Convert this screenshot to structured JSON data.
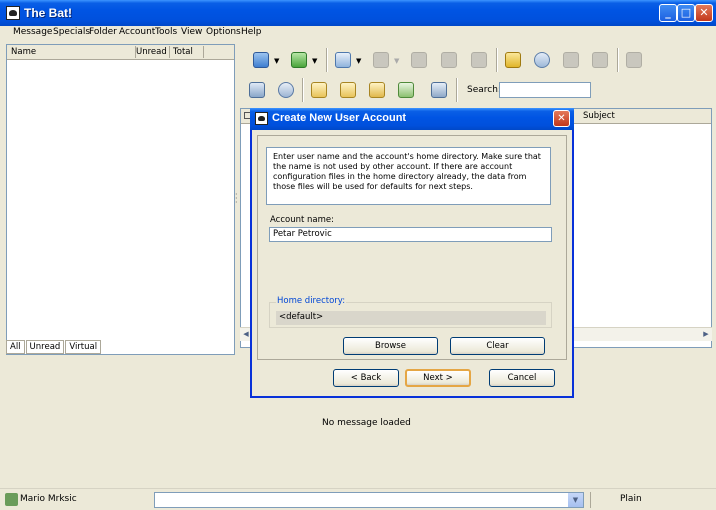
{
  "window": {
    "title": "The Bat!",
    "btn_min": "_",
    "btn_max": "□",
    "btn_close": "✕"
  },
  "menu": [
    "Message",
    "Specials",
    "Folder",
    "Account",
    "Tools",
    "View",
    "Options",
    "Help"
  ],
  "folder_pane": {
    "columns": [
      "Name",
      "Unread",
      "Total"
    ],
    "tabs": [
      "All",
      "Unread",
      "Virtual"
    ]
  },
  "search": {
    "label": "Search:",
    "value": ""
  },
  "message_list": {
    "subject_header": "Subject"
  },
  "preview": {
    "empty_text": "No message loaded"
  },
  "status": {
    "user": "Mario Mrksic",
    "mode": "Plain"
  },
  "dialog": {
    "title": "Create New User Account",
    "info": "Enter user name and the account's home directory. Make sure that the name is not used by other account. If there are account configuration files in the home directory already, the data from those files will be used for defaults for next steps.",
    "account_label": "Account name:",
    "account_value": "Petar Petrovic",
    "home_label": "Home directory:",
    "home_value": "<default>",
    "browse": "Browse",
    "clear": "Clear",
    "back": "< Back",
    "next": "Next >",
    "cancel": "Cancel"
  },
  "colors": {
    "title_blue": "#0054e3",
    "face": "#ece9d8",
    "border_blue": "#7f9db9",
    "link_blue": "#0046d5"
  },
  "toolbar_icons": [
    "get-mail-icon",
    "send-mail-icon",
    "new-message-icon",
    "reply-icon",
    "reply-all-icon",
    "forward-icon",
    "redirect-icon",
    "address-book-icon",
    "find-icon",
    "print-icon",
    "save-icon",
    "delete-icon",
    "inbox-icon",
    "scheduler-icon",
    "new-folder-icon",
    "folder-properties-icon",
    "filter-icon",
    "account-properties-icon",
    "sorting-office-icon"
  ]
}
